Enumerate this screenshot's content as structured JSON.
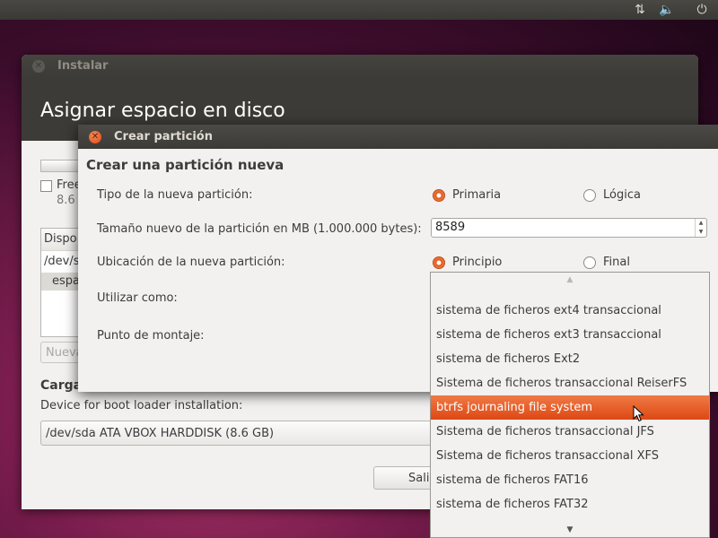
{
  "topbar": {
    "icons": [
      "network-arrows-icon",
      "volume-icon",
      "power-icon"
    ]
  },
  "install_window": {
    "title": "Instalar",
    "heading": "Asignar espacio en disco",
    "free_label": "Free",
    "free_size": "8.6",
    "table_header": "Dispo",
    "table_row1": "/dev/s",
    "table_row2": "espa",
    "new_button": "Nueva",
    "bootloader_heading": "Carga",
    "bootloader_label": "Device for boot loader installation:",
    "bootloader_value": "/dev/sda ATA VBOX HARDDISK (8.6 GB)",
    "quit_button": "Sali"
  },
  "dialog": {
    "title": "Crear partición",
    "heading": "Crear una partición nueva",
    "type_label": "Tipo de la nueva partición:",
    "type_primary": "Primaria",
    "type_logical": "Lógica",
    "size_label": "Tamaño nuevo de la partición en MB (1.000.000 bytes):",
    "size_value": "8589",
    "location_label": "Ubicación de la nueva partición:",
    "location_start": "Principio",
    "location_end": "Final",
    "use_as_label": "Utilizar como:",
    "mount_label": "Punto de montaje:"
  },
  "dropdown": {
    "items": [
      "sistema de ficheros ext4 transaccional",
      "sistema de ficheros ext3 transaccional",
      "sistema de ficheros Ext2",
      "Sistema de ficheros transaccional ReiserFS",
      "btrfs journaling file system",
      "Sistema de ficheros transaccional JFS",
      "Sistema de ficheros transaccional XFS",
      "sistema de ficheros FAT16",
      "sistema de ficheros FAT32"
    ],
    "selected": "btrfs journaling file system"
  },
  "colors": {
    "accent": "#dd4814",
    "titlebar": "#3c3b37",
    "window_bg": "#f2f1f0"
  }
}
